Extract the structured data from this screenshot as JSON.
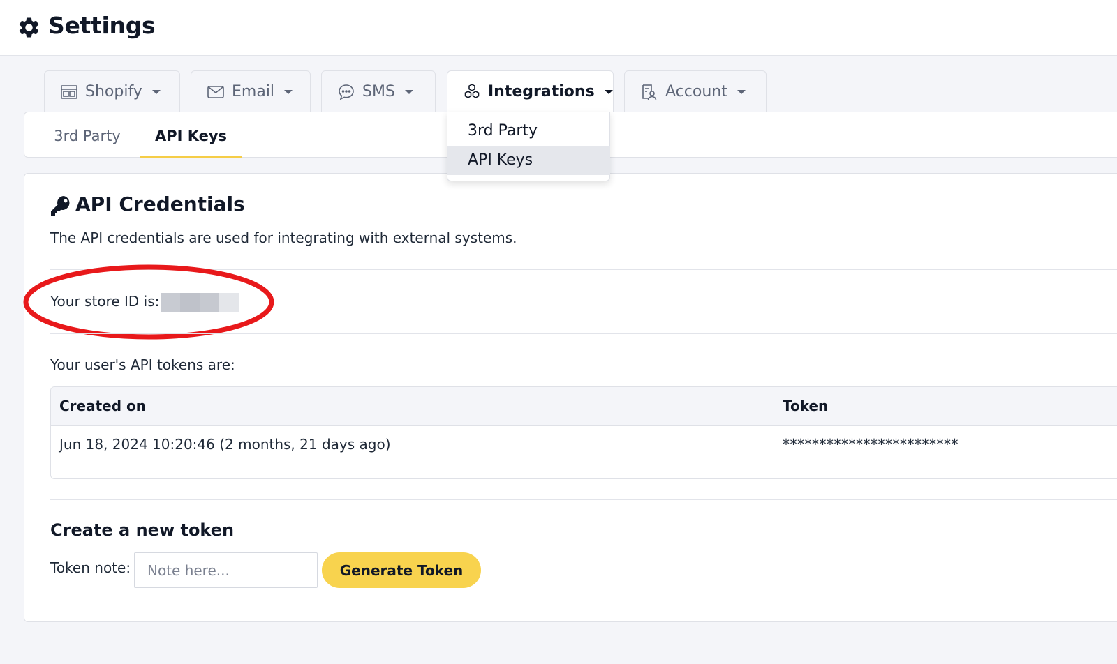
{
  "header": {
    "title": "Settings",
    "icon": "gear-icon"
  },
  "main_tabs": [
    {
      "label": "Shopify",
      "icon": "store-icon",
      "active": false
    },
    {
      "label": "Email",
      "icon": "envelope-icon",
      "active": false
    },
    {
      "label": "SMS",
      "icon": "chat-bubble-icon",
      "active": false
    },
    {
      "label": "Integrations",
      "icon": "cubes-icon",
      "active": true
    },
    {
      "label": "Account",
      "icon": "user-badge-icon",
      "active": false
    }
  ],
  "sub_tabs": [
    {
      "label": "3rd Party",
      "active": false
    },
    {
      "label": "API Keys",
      "active": true
    }
  ],
  "dropdown": {
    "items": [
      {
        "label": "3rd Party",
        "highlighted": false
      },
      {
        "label": "API Keys",
        "highlighted": true
      }
    ]
  },
  "card": {
    "icon": "key-icon",
    "title": "API Credentials",
    "description": "The API credentials are used for integrating with external systems.",
    "store_id_label": "Your store ID is:",
    "store_id_value_redacted": true,
    "tokens_label": "Your user's API tokens are:",
    "table": {
      "headers": [
        "Created on",
        "Token"
      ],
      "rows": [
        [
          "Jun 18, 2024 10:20:46 (2 months, 21 days ago)",
          "************************"
        ]
      ]
    },
    "create": {
      "title": "Create a new token",
      "note_label": "Token note:",
      "note_placeholder": "Note here...",
      "note_value": "",
      "button_label": "Generate Token"
    }
  },
  "colors": {
    "accent_yellow": "#f8d34e",
    "tab_underline": "#f5cd47",
    "annotation_red": "#e8191b",
    "page_bg": "#f4f5f9"
  }
}
